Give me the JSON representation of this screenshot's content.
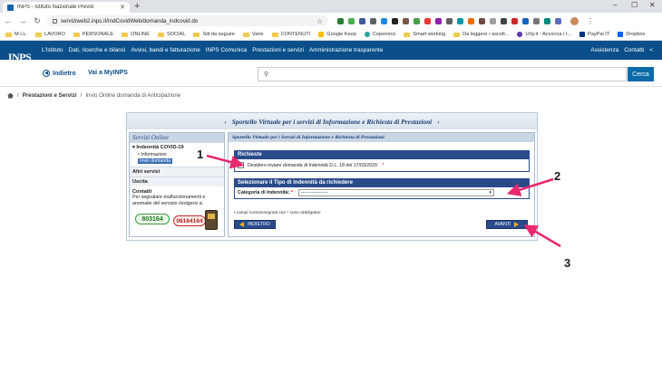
{
  "browser": {
    "tab_title": "INPS - Istituto Nazionale Previd",
    "url": "serviziweb2.inps.it/IndCovidWeb/domanda_indcovid.do",
    "bookmarks": [
      {
        "label": "M.I.L.",
        "type": "folder"
      },
      {
        "label": "LAVORO",
        "type": "folder"
      },
      {
        "label": "PERSONALE",
        "type": "folder"
      },
      {
        "label": "ONLINE",
        "type": "folder"
      },
      {
        "label": "SOCIAL",
        "type": "folder"
      },
      {
        "label": "Siti da seguire",
        "type": "folder"
      },
      {
        "label": "Varie",
        "type": "folder"
      },
      {
        "label": "CONTENUTI",
        "type": "folder"
      },
      {
        "label": "Google Keep",
        "type": "site"
      },
      {
        "label": "Copernico",
        "type": "site"
      },
      {
        "label": "Smart working",
        "type": "folder"
      },
      {
        "label": "Da leggere / ascolt...",
        "type": "folder"
      },
      {
        "label": "Urly.it - Accorcia i t...",
        "type": "site"
      },
      {
        "label": "PayPal IT",
        "type": "site"
      },
      {
        "label": "Dropbox",
        "type": "site"
      }
    ]
  },
  "inps": {
    "logo": "INPS",
    "nav": [
      "L'Istituto",
      "Dati, ricerche e bilanci",
      "Avvisi, bandi e fatturazione",
      "INPS Comunica",
      "Prestazioni e servizi",
      "Amministrazione trasparente"
    ],
    "right_links": [
      "Assistenza",
      "Contatti"
    ],
    "back_label": "Indietro",
    "myinps_label": "Vai a MyINPS",
    "search_button": "Cerca",
    "breadcrumb": {
      "section": "Prestazioni e Servizi",
      "current": "Invio Online domanda di Anticipazione"
    }
  },
  "portal": {
    "title": "Sportello Virtuale per i servizi di Informazione e Richiesta di Prestazioni",
    "sidebar": {
      "header": "Servizi Online",
      "section": "Indennità COVID-19",
      "items": [
        "Informazioni",
        "Invio domanda"
      ],
      "other": "Altri servizi",
      "exit": "Uscita",
      "contacts_title": "Contatti",
      "contacts_text": "Per segnalare malfunzionamenti e anomalie del servizio rivolgersi a:",
      "phone_green": "803164",
      "phone_red": "06164164"
    },
    "content_title": "Sportello Virtuale per i Servizi di Informazione e Richiesta di Prestazioni",
    "requests": {
      "header": "Richieste",
      "checkbox_label": "Desidero inviare domanda di Indennità D.L. 18 del 17/03/2020.",
      "required": "*"
    },
    "type": {
      "header": "Selezionare il Tipo di Indennità da richiedere",
      "label": "Categoria di Indennità:",
      "select_value": "------------------"
    },
    "note": "I campi contrassegnati con * sono obbligatori",
    "back_button": "INDIETRO",
    "next_button": "AVANTI"
  },
  "annotations": [
    "1",
    "2",
    "3"
  ],
  "colors": {
    "inps_blue": "#0a4f8a",
    "portal_blue": "#2a4a8a",
    "arrow_pink": "#e8286f"
  }
}
